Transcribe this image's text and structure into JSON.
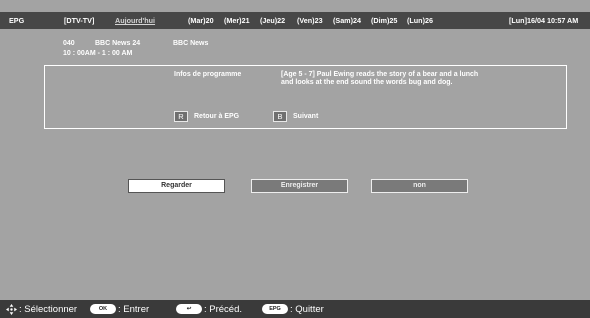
{
  "header": {
    "epg": "EPG",
    "source": "[DTV-TV]",
    "today": "Aujourd'hui",
    "days": [
      "(Mar)20",
      "(Mer)21",
      "(Jeu)22",
      "(Ven)23",
      "(Sam)24",
      "(Dim)25",
      "(Lun)26"
    ],
    "datetime": "[Lun]16/04 10:57 AM"
  },
  "channel": {
    "number": "040",
    "name": "BBC News 24",
    "time": "10 : 00AM - 1 : 00 AM",
    "program": "BBC News"
  },
  "info": {
    "label": "Infos de programme",
    "description": "[Age 5 - 7] Paul Ewing reads the story of a bear and a lunch and looks at the end sound the words bug and dog.",
    "key_r": "R",
    "key_r_label": "Retour à EPG",
    "key_b": "B",
    "key_b_label": "Suivant"
  },
  "buttons": {
    "watch": "Regarder",
    "record": "Enregistrer",
    "no": "non"
  },
  "footer": {
    "select": ": Sélectionner",
    "ok_key": "OK",
    "enter": ": Entrer",
    "back_key": "↩",
    "previous": ": Précéd.",
    "epg_key": "EPG",
    "quit": ": Quitter"
  },
  "colors": {
    "background": "#a3a3a3",
    "topbar": "#474747",
    "footer": "#3a3a3a"
  }
}
